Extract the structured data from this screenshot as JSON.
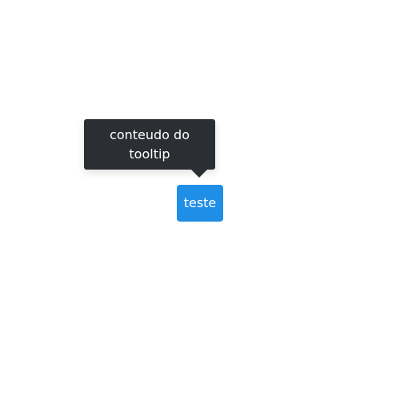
{
  "tooltip": {
    "text": "conteudo do tooltip"
  },
  "button": {
    "label": "teste"
  },
  "colors": {
    "tooltip_background": "#2b2f33",
    "button_background": "#1f8ee6",
    "text": "#ffffff",
    "page_background": "#ffffff"
  }
}
